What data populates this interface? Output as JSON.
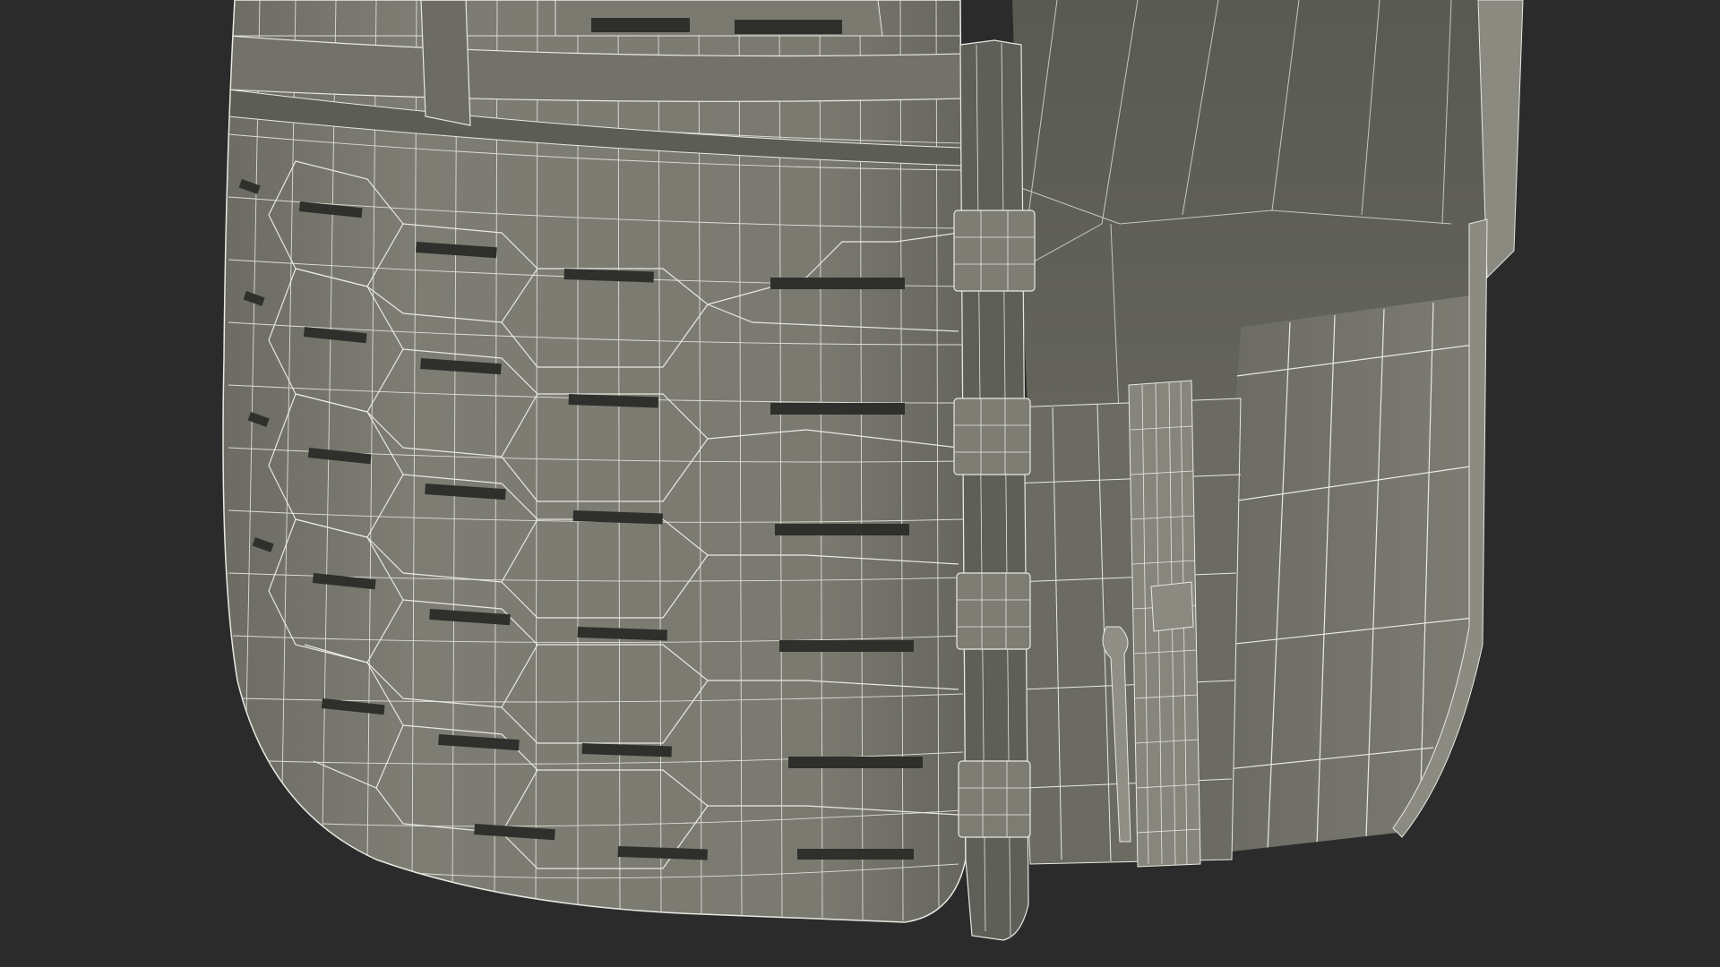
{
  "scene": {
    "subject": "plate-carrier-vest-wireframe",
    "background_color": "#2b2b2b",
    "shell_color": "#7b7b72",
    "shell_shadow_color": "#5f5f58",
    "inner_color": "#6e6e66",
    "inner_shadow_color": "#4a4a45",
    "slot_color": "#2f2f2c",
    "wire_color": "#e9e9e2"
  }
}
